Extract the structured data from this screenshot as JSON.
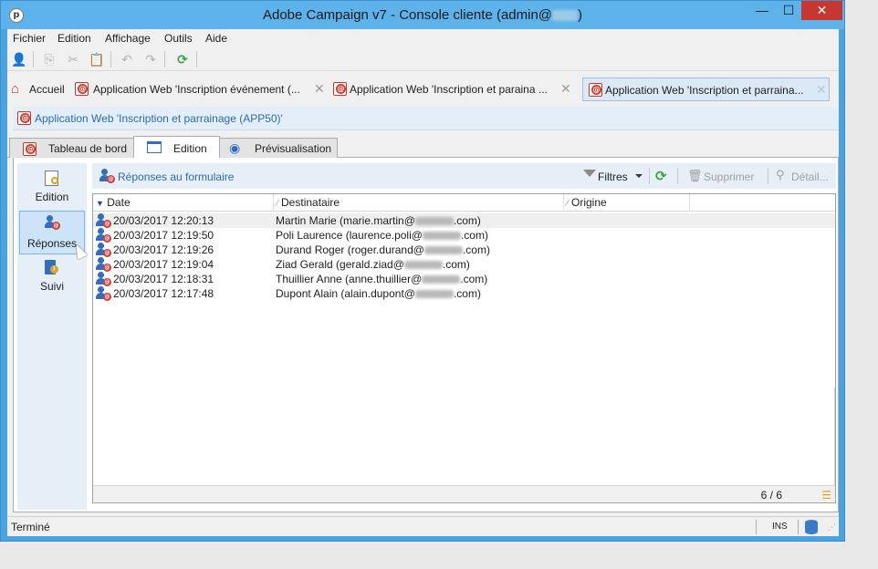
{
  "window": {
    "title_prefix": "Adobe Campaign v7 - Console cliente (admin@",
    "title_suffix": ")",
    "min_glyph": "—",
    "max_glyph": "☐",
    "close_glyph": "✕"
  },
  "menu": [
    {
      "label": "Fichier"
    },
    {
      "label": "Edition"
    },
    {
      "label": "Affichage"
    },
    {
      "label": "Outils"
    },
    {
      "label": "Aide"
    }
  ],
  "doc_tabs": [
    {
      "label": "Accueil"
    },
    {
      "label": "Application Web 'Inscription événement (..."
    },
    {
      "label": "Application Web 'Inscription et paraina ..."
    },
    {
      "label": "Application Web 'Inscription et parraina..."
    }
  ],
  "breadcrumb": "Application Web 'Inscription et parrainage (APP50)'",
  "sub_tabs": [
    {
      "label": "Tableau de bord"
    },
    {
      "label": "Edition"
    },
    {
      "label": "Prévisualisation"
    }
  ],
  "left_nav": [
    {
      "label": "Edition"
    },
    {
      "label": "Réponses"
    },
    {
      "label": "Suivi"
    }
  ],
  "content_toolbar": {
    "title": "Réponses au formulaire",
    "filters": "Filtres",
    "delete": "Supprimer",
    "detail": "Détail..."
  },
  "grid": {
    "columns": [
      "Date",
      "Destinataire",
      "Origine"
    ],
    "rows": [
      {
        "date": "20/03/2017 12:20:13",
        "name_prefix": "Martin Marie (marie.martin@",
        "name_suffix": ".com)"
      },
      {
        "date": "20/03/2017 12:19:50",
        "name_prefix": "Poli Laurence (laurence.poli@",
        "name_suffix": ".com)"
      },
      {
        "date": "20/03/2017 12:19:26",
        "name_prefix": "Durand Roger (roger.durand@",
        "name_suffix": ".com)"
      },
      {
        "date": "20/03/2017 12:19:04",
        "name_prefix": "Ziad Gerald (gerald.ziad@",
        "name_suffix": ".com)"
      },
      {
        "date": "20/03/2017 12:18:31",
        "name_prefix": "Thuillier Anne (anne.thuillier@",
        "name_suffix": ".com)"
      },
      {
        "date": "20/03/2017 12:17:48",
        "name_prefix": "Dupont Alain (alain.dupont@",
        "name_suffix": ".com)"
      }
    ],
    "count": "6 / 6"
  },
  "status": {
    "text": "Terminé",
    "ins": "INS"
  },
  "colors": {
    "titlebar": "#5eb2ea",
    "accent_blue": "#2a6bb0",
    "close_red": "#c7372f",
    "campaign_red": "#d33b30"
  }
}
